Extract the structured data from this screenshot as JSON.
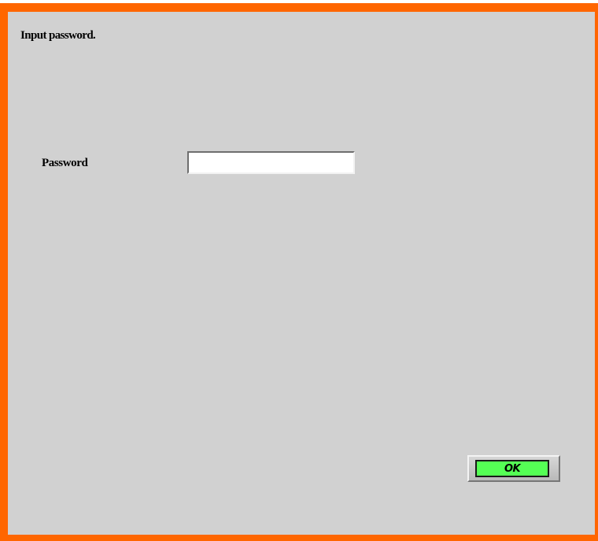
{
  "dialog": {
    "heading": "Input password.",
    "password_label": "Password",
    "password_value": "",
    "ok_label": "OK"
  },
  "colors": {
    "frame": "#ff6600",
    "panel": "#d1d1d1",
    "ok_face": "#55ff55"
  }
}
